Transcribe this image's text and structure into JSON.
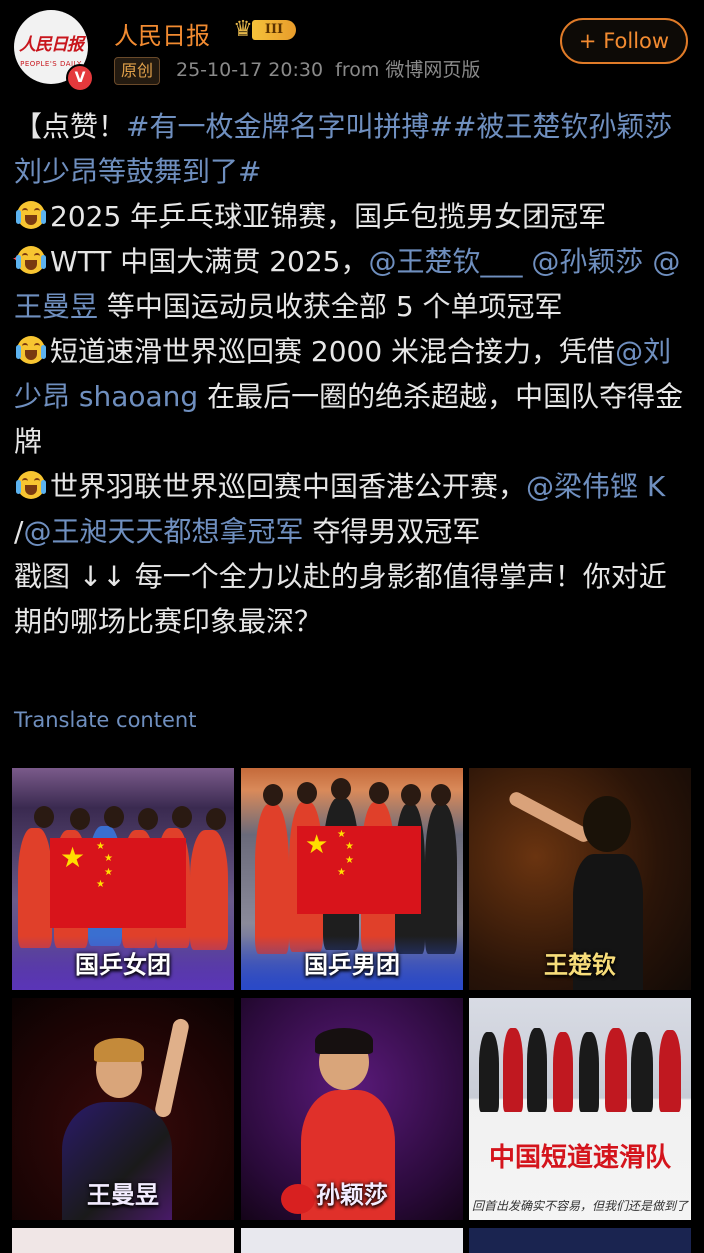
{
  "account": {
    "name": "人民日报",
    "logo_cn": "人民日报",
    "logo_en": "PEOPLE'S DAILY",
    "verified_mark": "V",
    "level_badge": "III",
    "original_tag": "原创",
    "timestamp": "25-10-17 20:30",
    "source": "from 微博网页版",
    "follow_label": "+ Follow"
  },
  "post": {
    "line1_prefix": "【点赞！",
    "topic1": "#有一枚金牌名字叫拼搏#",
    "topic2": "#被王楚钦孙颖莎刘少昂等鼓舞到了#",
    "item1": "2025 年乒乓球亚锦赛，国乒包揽男女团冠军",
    "item2_prefix": "WTT 中国大满贯 2025，",
    "mention1": "@王楚钦___",
    "mention2": "@孙颖莎",
    "mention3": "@王曼昱",
    "item2_suffix": "等中国运动员收获全部 5 个单项冠军",
    "item3_prefix": "短道速滑世界巡回赛 2000 米混合接力，凭借",
    "mention4": "@刘少昂 shaoang",
    "item3_suffix": "在最后一圈的绝杀超越，中国队夺得金牌",
    "item4_prefix": "世界羽联世界巡回赛中国香港公开赛，",
    "mention5": "@梁伟铿 K",
    "item4_sep": "/",
    "mention6": "@王昶天天都想拿冠军",
    "item4_suffix": "夺得男双冠军",
    "closing": "戳图 ↓↓ 每一个全力以赴的身影都值得掌声！你对近期的哪场比赛印象最深？"
  },
  "translate_label": "Translate content",
  "images": [
    {
      "caption": "国乒女团"
    },
    {
      "caption": "国乒男团"
    },
    {
      "caption": "王楚钦"
    },
    {
      "caption": "王曼昱"
    },
    {
      "caption": "孙颖莎"
    },
    {
      "caption": "中国短道速滑队",
      "subcaption": "回首出发确实不容易，但我们还是做到了"
    }
  ],
  "colors": {
    "accent_orange": "#f28b31",
    "link_blue": "#6f8fbf",
    "background": "#000000"
  },
  "icons": [
    "crown-icon",
    "verified-icon",
    "cry-emoji-icon",
    "plus-icon"
  ]
}
